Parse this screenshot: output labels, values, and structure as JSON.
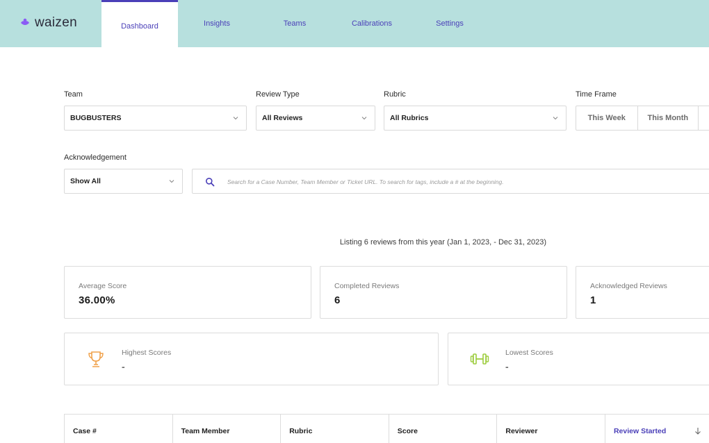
{
  "brand": {
    "name": "waizen"
  },
  "nav": {
    "tabs": [
      {
        "label": "Dashboard",
        "active": true
      },
      {
        "label": "Insights",
        "active": false
      },
      {
        "label": "Teams",
        "active": false
      },
      {
        "label": "Calibrations",
        "active": false
      },
      {
        "label": "Settings",
        "active": false
      }
    ]
  },
  "filters": {
    "team": {
      "label": "Team",
      "value": "BUGBUSTERS"
    },
    "review_type": {
      "label": "Review Type",
      "value": "All Reviews"
    },
    "rubric": {
      "label": "Rubric",
      "value": "All Rubrics"
    },
    "time_frame": {
      "label": "Time Frame",
      "options": [
        "This Week",
        "This Month"
      ]
    },
    "acknowledgement": {
      "label": "Acknowledgement",
      "value": "Show All"
    },
    "search": {
      "placeholder": "Search for a Case Number, Team Member or Ticket URL. To search for tags, include a # at the beginning."
    }
  },
  "listing_text": "Listing 6 reviews from this year (Jan 1, 2023, - Dec 31, 2023)",
  "stats": {
    "average_score": {
      "label": "Average Score",
      "value": "36.00%"
    },
    "completed_reviews": {
      "label": "Completed Reviews",
      "value": "6"
    },
    "acknowledged_reviews": {
      "label": "Acknowledged Reviews",
      "value": "1"
    },
    "highest_scores": {
      "label": "Highest Scores",
      "value": "-"
    },
    "lowest_scores": {
      "label": "Lowest Scores",
      "value": "-"
    }
  },
  "table": {
    "columns": [
      "Case #",
      "Team Member",
      "Rubric",
      "Score",
      "Reviewer",
      "Review Started"
    ],
    "sorted_column": "Review Started"
  },
  "colors": {
    "topbar": "#b7e0de",
    "accent": "#4a3fb8",
    "trophy": "#f0a14a",
    "dumbbell": "#9ccc3c"
  },
  "icons": [
    "logo-icon",
    "chevron-down-icon",
    "search-icon",
    "trophy-icon",
    "dumbbell-icon",
    "sort-arrow-down-icon"
  ]
}
